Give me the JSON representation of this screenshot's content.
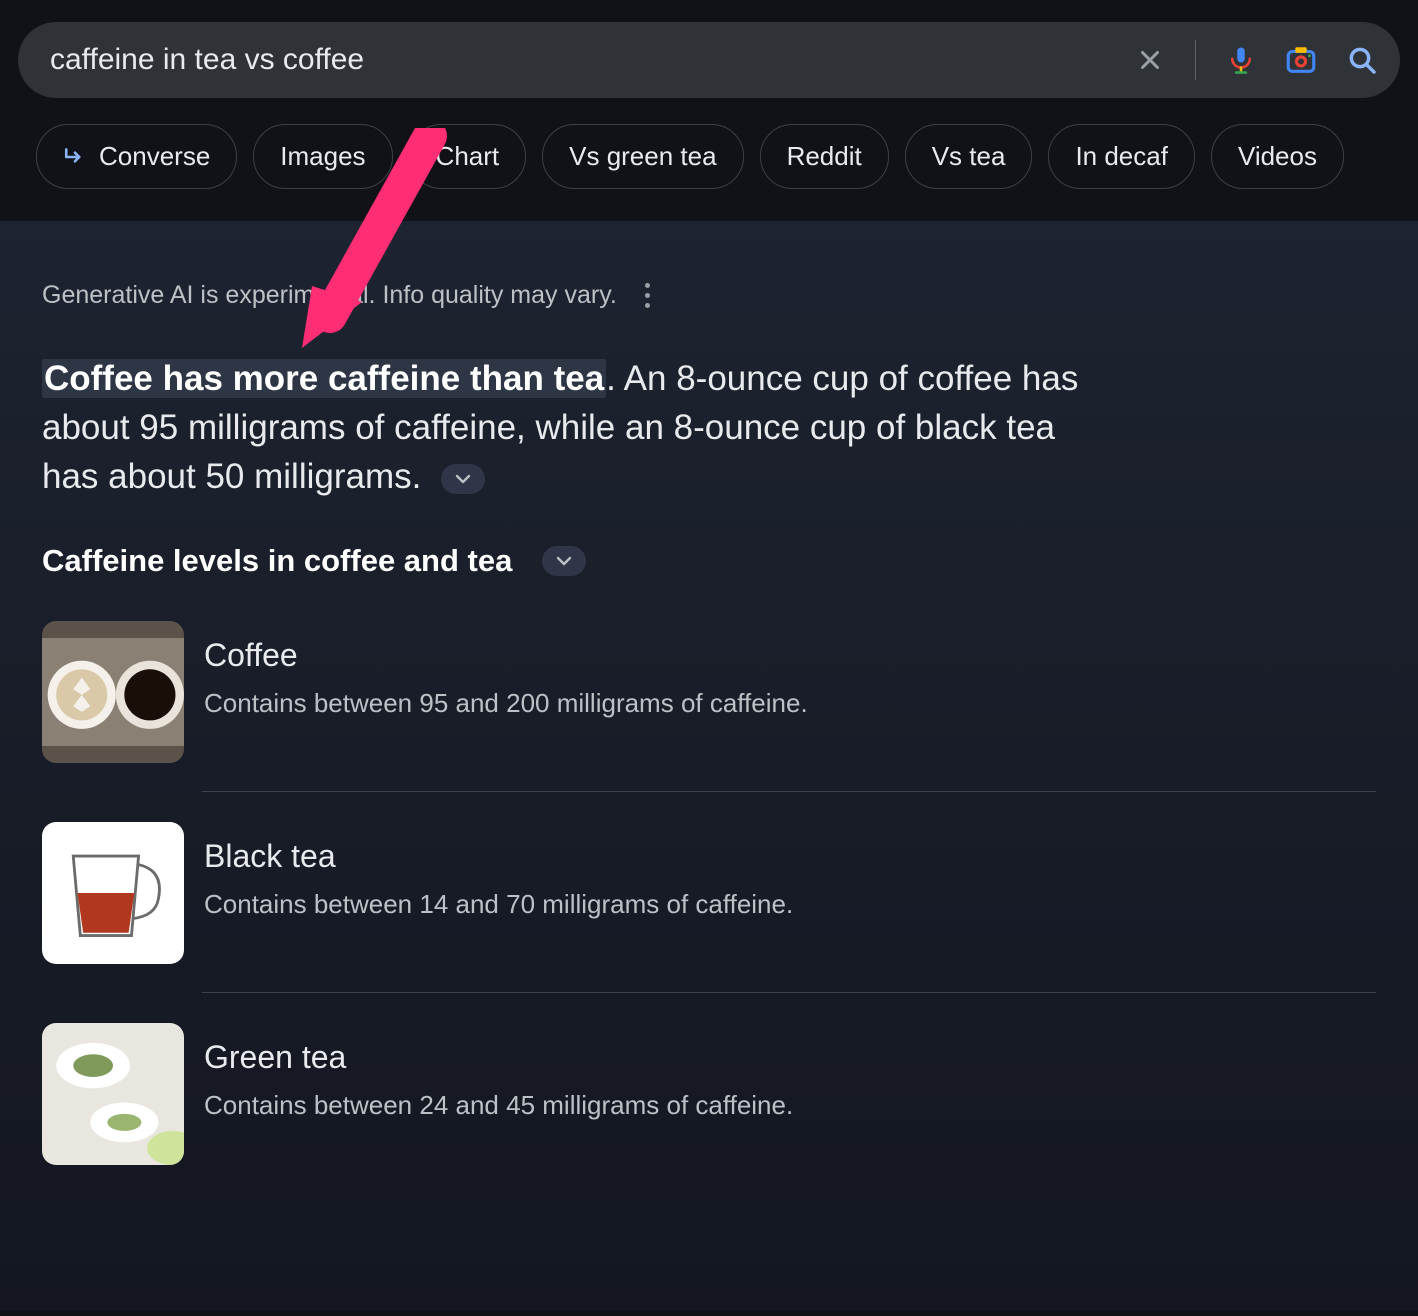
{
  "search": {
    "query": "caffeine in tea vs coffee"
  },
  "chips": [
    "Converse",
    "Images",
    "Chart",
    "Vs green tea",
    "Reddit",
    "Vs tea",
    "In decaf",
    "Videos"
  ],
  "ai": {
    "disclaimer": "Generative AI is experimental. Info quality may vary.",
    "highlight": "Coffee has more caffeine than tea",
    "summary_rest": ". An 8-ounce cup of coffee has about 95 milligrams of caffeine, while an 8-ounce cup of black tea has about 50 milligrams.",
    "subheading": "Caffeine levels in coffee and tea",
    "items": [
      {
        "title": "Coffee",
        "desc": "Contains between 95 and 200 milligrams of caffeine."
      },
      {
        "title": "Black tea",
        "desc": "Contains between 14 and 70 milligrams of caffeine."
      },
      {
        "title": "Green tea",
        "desc": "Contains between 24 and 45 milligrams of caffeine."
      }
    ]
  }
}
